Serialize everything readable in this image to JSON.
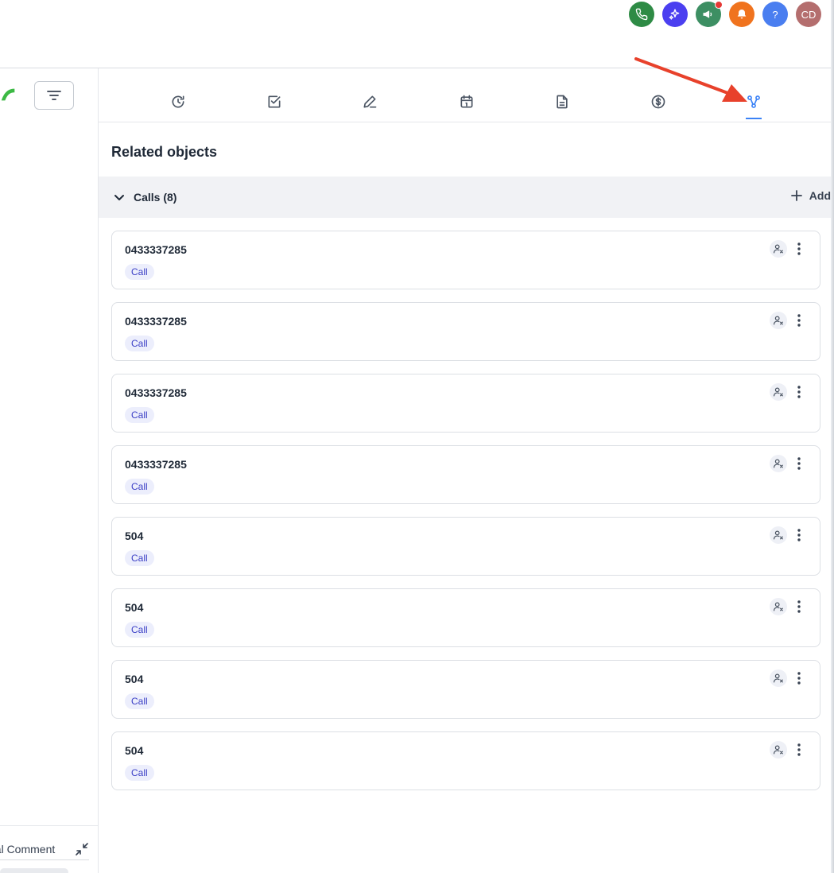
{
  "topbar": {
    "icons": [
      {
        "name": "phone-icon",
        "color": "#2e8b45"
      },
      {
        "name": "sparkle-icon",
        "color": "#4b3ff0"
      },
      {
        "name": "megaphone-icon",
        "color": "#3d8f63",
        "has_dot": true
      },
      {
        "name": "bell-icon",
        "color": "#f0731e"
      },
      {
        "name": "help-icon",
        "color": "#4a7ef0"
      },
      {
        "name": "avatar",
        "color": "#b46e6e"
      }
    ],
    "help_label": "?",
    "avatar_initials": "CD"
  },
  "left_panel": {
    "comment_label": "nal Comment"
  },
  "tabs": [
    {
      "name": "tab-activity",
      "icon": "clock-refresh-icon",
      "active": false
    },
    {
      "name": "tab-tasks",
      "icon": "checkbox-icon",
      "active": false
    },
    {
      "name": "tab-notes",
      "icon": "pen-icon",
      "active": false
    },
    {
      "name": "tab-meetings",
      "icon": "calendar-icon",
      "active": false
    },
    {
      "name": "tab-documents",
      "icon": "document-icon",
      "active": false
    },
    {
      "name": "tab-deals",
      "icon": "dollar-icon",
      "active": false
    },
    {
      "name": "tab-related",
      "icon": "relation-icon",
      "active": true
    }
  ],
  "section": {
    "title": "Related objects"
  },
  "group": {
    "label": "Calls (8)",
    "add_label": "Add"
  },
  "cards": [
    {
      "title": "0433337285",
      "badge": "Call"
    },
    {
      "title": "0433337285",
      "badge": "Call"
    },
    {
      "title": "0433337285",
      "badge": "Call"
    },
    {
      "title": "0433337285",
      "badge": "Call"
    },
    {
      "title": "504",
      "badge": "Call"
    },
    {
      "title": "504",
      "badge": "Call"
    },
    {
      "title": "504",
      "badge": "Call"
    },
    {
      "title": "504",
      "badge": "Call"
    }
  ],
  "colors": {
    "accent": "#3b82f6",
    "badge_bg": "#eceefc",
    "badge_text": "#3c40c6",
    "annotation_arrow": "#e8412b"
  }
}
